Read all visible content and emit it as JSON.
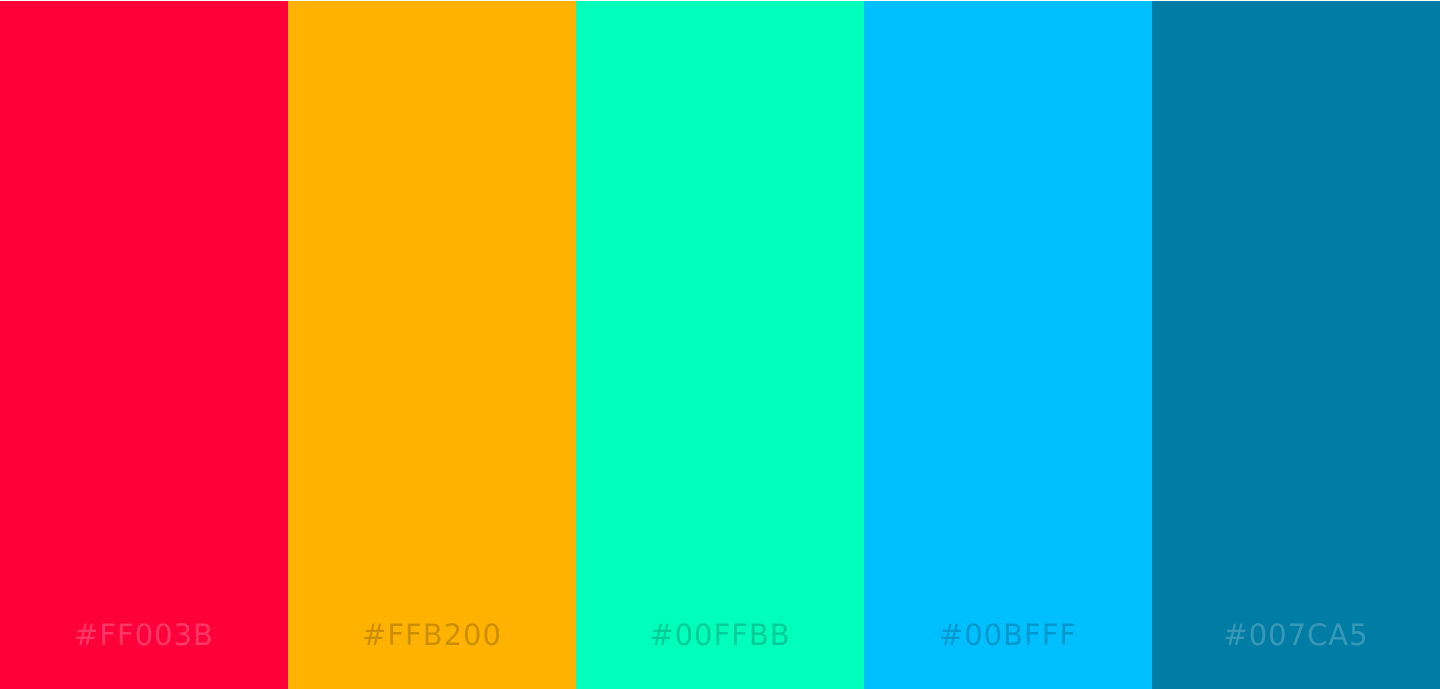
{
  "palette": {
    "swatches": [
      {
        "hex": "#FF003B",
        "color": "#FF003B"
      },
      {
        "hex": "#FFB200",
        "color": "#FFB200"
      },
      {
        "hex": "#00FFBB",
        "color": "#00FFBB"
      },
      {
        "hex": "#00BFFF",
        "color": "#00BFFF"
      },
      {
        "hex": "#007CA5",
        "color": "#007CA5"
      }
    ]
  }
}
